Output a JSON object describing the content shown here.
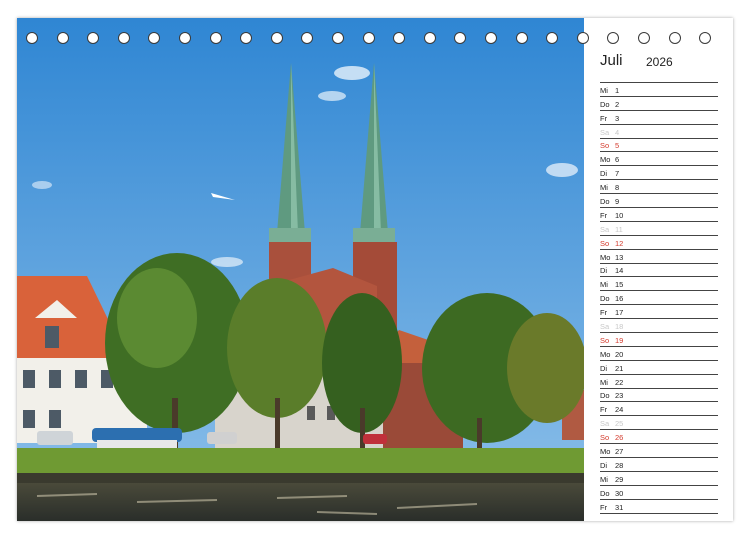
{
  "calendar": {
    "month": "Juli",
    "year": "2026",
    "days": [
      {
        "dn": "Mi",
        "d": "1"
      },
      {
        "dn": "Do",
        "d": "2"
      },
      {
        "dn": "Fr",
        "d": "3"
      },
      {
        "dn": "Sa",
        "d": "4"
      },
      {
        "dn": "So",
        "d": "5"
      },
      {
        "dn": "Mo",
        "d": "6"
      },
      {
        "dn": "Di",
        "d": "7"
      },
      {
        "dn": "Mi",
        "d": "8"
      },
      {
        "dn": "Do",
        "d": "9"
      },
      {
        "dn": "Fr",
        "d": "10"
      },
      {
        "dn": "Sa",
        "d": "11"
      },
      {
        "dn": "So",
        "d": "12"
      },
      {
        "dn": "Mo",
        "d": "13"
      },
      {
        "dn": "Di",
        "d": "14"
      },
      {
        "dn": "Mi",
        "d": "15"
      },
      {
        "dn": "Do",
        "d": "16"
      },
      {
        "dn": "Fr",
        "d": "17"
      },
      {
        "dn": "Sa",
        "d": "18"
      },
      {
        "dn": "So",
        "d": "19"
      },
      {
        "dn": "Mo",
        "d": "20"
      },
      {
        "dn": "Di",
        "d": "21"
      },
      {
        "dn": "Mi",
        "d": "22"
      },
      {
        "dn": "Do",
        "d": "23"
      },
      {
        "dn": "Fr",
        "d": "24"
      },
      {
        "dn": "Sa",
        "d": "25"
      },
      {
        "dn": "So",
        "d": "26"
      },
      {
        "dn": "Mo",
        "d": "27"
      },
      {
        "dn": "Di",
        "d": "28"
      },
      {
        "dn": "Mi",
        "d": "29"
      },
      {
        "dn": "Do",
        "d": "30"
      },
      {
        "dn": "Fr",
        "d": "31"
      }
    ]
  },
  "binding": {
    "hole_count": 23
  },
  "colors": {
    "sunday": "#d33a2c",
    "saturday": "#c8c8c8",
    "sky": "#3f8fd6",
    "spire": "#6fa88a",
    "brick": "#b0503a"
  }
}
